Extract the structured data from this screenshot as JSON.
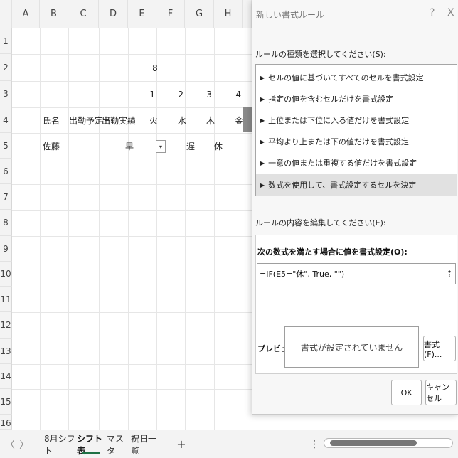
{
  "sheet": {
    "columns": [
      "A",
      "B",
      "C",
      "D",
      "E",
      "F",
      "G",
      "H"
    ],
    "rows": [
      "1",
      "2",
      "3",
      "4",
      "5",
      "6",
      "7",
      "8",
      "9",
      "10",
      "11",
      "12",
      "13",
      "14",
      "15",
      "16"
    ],
    "cells": {
      "e2": "8",
      "e3": "1",
      "f3": "2",
      "g3": "3",
      "h3": "4",
      "b4": "氏名",
      "c4": "出勤予定日",
      "d4": "出勤実績",
      "e4": "火",
      "f4": "水",
      "g4": "木",
      "h4": "金",
      "b5": "佐藤",
      "d5": "早",
      "f5": "遅",
      "g5": "休"
    },
    "dropdown_glyph": "▾"
  },
  "tabs": {
    "prev": "〈",
    "next": "〉",
    "items": [
      "8月シフト",
      "シフト表",
      "マスタ",
      "祝日一覧"
    ],
    "active_index": 1,
    "add": "+",
    "more": "⋮"
  },
  "dialog": {
    "title": "新しい書式ルール",
    "help": "?",
    "close": "X",
    "type_label": "ルールの種類を選択してください(S):",
    "rule_types": [
      "セルの値に基づいてすべてのセルを書式設定",
      "指定の値を含むセルだけを書式設定",
      "上位または下位に入る値だけを書式設定",
      "平均より上または下の値だけを書式設定",
      "一意の値または重複する値だけを書式設定",
      "数式を使用して、書式設定するセルを決定"
    ],
    "selected_index": 5,
    "edit_label": "ルールの内容を編集してください(E):",
    "formula_heading": "次の数式を満たす場合に値を書式設定(O):",
    "formula_value": "=IF(E5=\"休\", True, \"\")",
    "collapse_icon": "⇡",
    "preview_label": "プレビュー:",
    "preview_text": "書式が設定されていません",
    "format_button": "書式(F)...",
    "ok_button": "OK",
    "cancel_button": "キャンセル"
  }
}
